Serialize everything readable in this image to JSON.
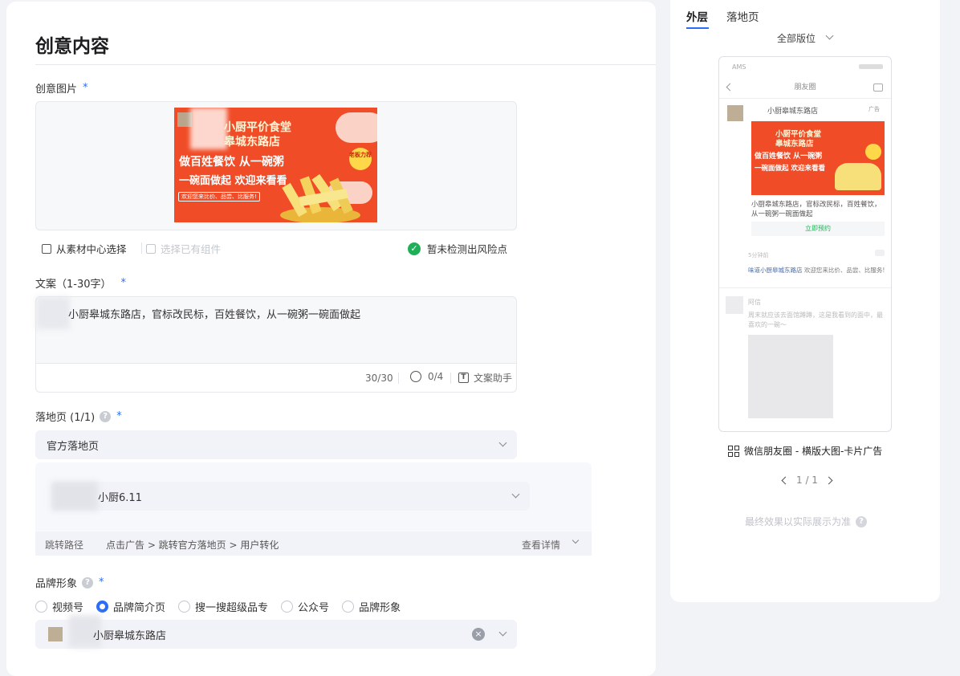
{
  "main": {
    "title": "创意内容",
    "image_section": {
      "label": "创意图片",
      "required_mark": "*",
      "banner_text": {
        "line1": "小厨平价食堂",
        "line2": "皋城东路店",
        "line3": "做百姓餐饮 从一碗粥",
        "line4": "一碗面做起 欢迎来看看",
        "small": "欢迎您来比价、品尝、比服务!",
        "badge": "老板力荐"
      },
      "select_from_library": "从素材中心选择",
      "select_existing": "选择已有组件",
      "risk_status": "暂未检测出风险点"
    },
    "copy_section": {
      "label": "文案（1-30字）",
      "required_mark": "*",
      "value": "小厨皋城东路店，官标改民标，百姓餐饮，从一碗粥一碗面做起",
      "char_count": "30/30",
      "emoji_count": "0/4",
      "assistant": "文案助手"
    },
    "landing_section": {
      "label": "落地页 (1/1)",
      "help": "?",
      "required_mark": "*",
      "type_value": "官方落地页",
      "page_value": "小厨6.11",
      "path_label": "跳转路径",
      "path_value": "点击广告 > 跳转官方落地页 > 用户转化",
      "details_link": "查看详情"
    },
    "brand_section": {
      "label": "品牌形象",
      "help": "?",
      "required_mark": "*",
      "options": [
        "视频号",
        "品牌简介页",
        "搜一搜超级品专",
        "公众号",
        "品牌形象"
      ],
      "selected_index": 1,
      "selected_value": "小厨皋城东路店"
    }
  },
  "preview": {
    "tabs": [
      "外层",
      "落地页"
    ],
    "active_tab": 0,
    "placement_filter": "全部版位",
    "phone": {
      "carrier": "AMS",
      "nav_title": "朋友圈",
      "account_name": "小厨皋城东路店",
      "ad_tag": "广告",
      "caption": "小厨皋城东路店，官标改民标，百姓餐饮，从一碗粥一碗面做起",
      "cta": "立即预约",
      "meta": "5分钟前",
      "comment_user": "味道小厨皋城东路店",
      "comment_text": "欢迎您来比价、品尝、比服务!",
      "friend_name": "阿信",
      "friend_text": "周末就应该去面馆蹲蹲，这是我看到的面中，最喜欢的一碗～"
    },
    "caption": "微信朋友圈 - 横版大图-卡片广告",
    "pager": "1 / 1",
    "disclaimer": "最终效果以实际展示为准",
    "help": "?"
  },
  "colors": {
    "accent": "#2c6df7",
    "banner": "#f04c27",
    "success": "#1fb057"
  }
}
